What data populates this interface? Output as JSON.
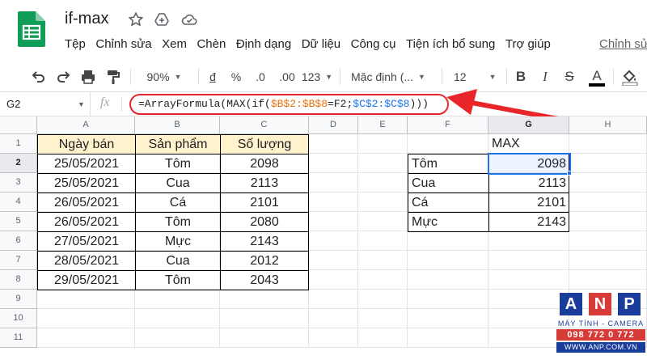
{
  "app": {
    "title": "if-max",
    "menu": [
      "Tệp",
      "Chỉnh sửa",
      "Xem",
      "Chèn",
      "Định dạng",
      "Dữ liệu",
      "Công cụ",
      "Tiện ích bổ sung",
      "Trợ giúp"
    ],
    "menu_link": "Chỉnh sửa"
  },
  "toolbar": {
    "zoom": "90%",
    "currency": "đ",
    "percent": "%",
    "decrease_decimals": ".0",
    "increase_decimals": ".00",
    "more_formats": "123",
    "font": "Mặc định (...",
    "font_size": "12",
    "bold": "B",
    "italic": "I",
    "strikethrough": "S",
    "text_color": "A"
  },
  "formula_bar": {
    "cell_ref": "G2",
    "fx": "fx",
    "formula_parts": [
      "=ArrayFormula(MAX(if(",
      "$B$2:$B$8",
      "=F2;",
      "$C$2:$C$8",
      ")))"
    ]
  },
  "grid": {
    "columns": [
      "A",
      "B",
      "C",
      "D",
      "E",
      "F",
      "G",
      "H"
    ],
    "rows": [
      "1",
      "2",
      "3",
      "4",
      "5",
      "6",
      "7",
      "8",
      "9",
      "10",
      "11"
    ],
    "selected_column": "G",
    "selected_row": "2"
  },
  "table": {
    "headers": [
      "Ngày bán",
      "Sản phẩm",
      "Số lượng"
    ],
    "rows": [
      [
        "25/05/2021",
        "Tôm",
        "2098"
      ],
      [
        "25/05/2021",
        "Cua",
        "2113"
      ],
      [
        "26/05/2021",
        "Cá",
        "2101"
      ],
      [
        "26/05/2021",
        "Tôm",
        "2080"
      ],
      [
        "27/05/2021",
        "Mực",
        "2143"
      ],
      [
        "28/05/2021",
        "Cua",
        "2012"
      ],
      [
        "29/05/2021",
        "Tôm",
        "2043"
      ]
    ]
  },
  "summary": {
    "header": "MAX",
    "rows": [
      [
        "Tôm",
        "2098"
      ],
      [
        "Cua",
        "2113"
      ],
      [
        "Cá",
        "2101"
      ],
      [
        "Mực",
        "2143"
      ]
    ]
  },
  "watermark": {
    "letters": [
      "A",
      "N",
      "P"
    ],
    "subtitle": "MÁY TÍNH - CAMERA",
    "phone": "098 772 0 772",
    "website": "WWW.ANP.COM.VN"
  },
  "colors": {
    "accent": "#1a73e8",
    "annotation": "#e8262a",
    "header_fill": "#fff2cc",
    "sheets_green": "#0f9d58"
  }
}
